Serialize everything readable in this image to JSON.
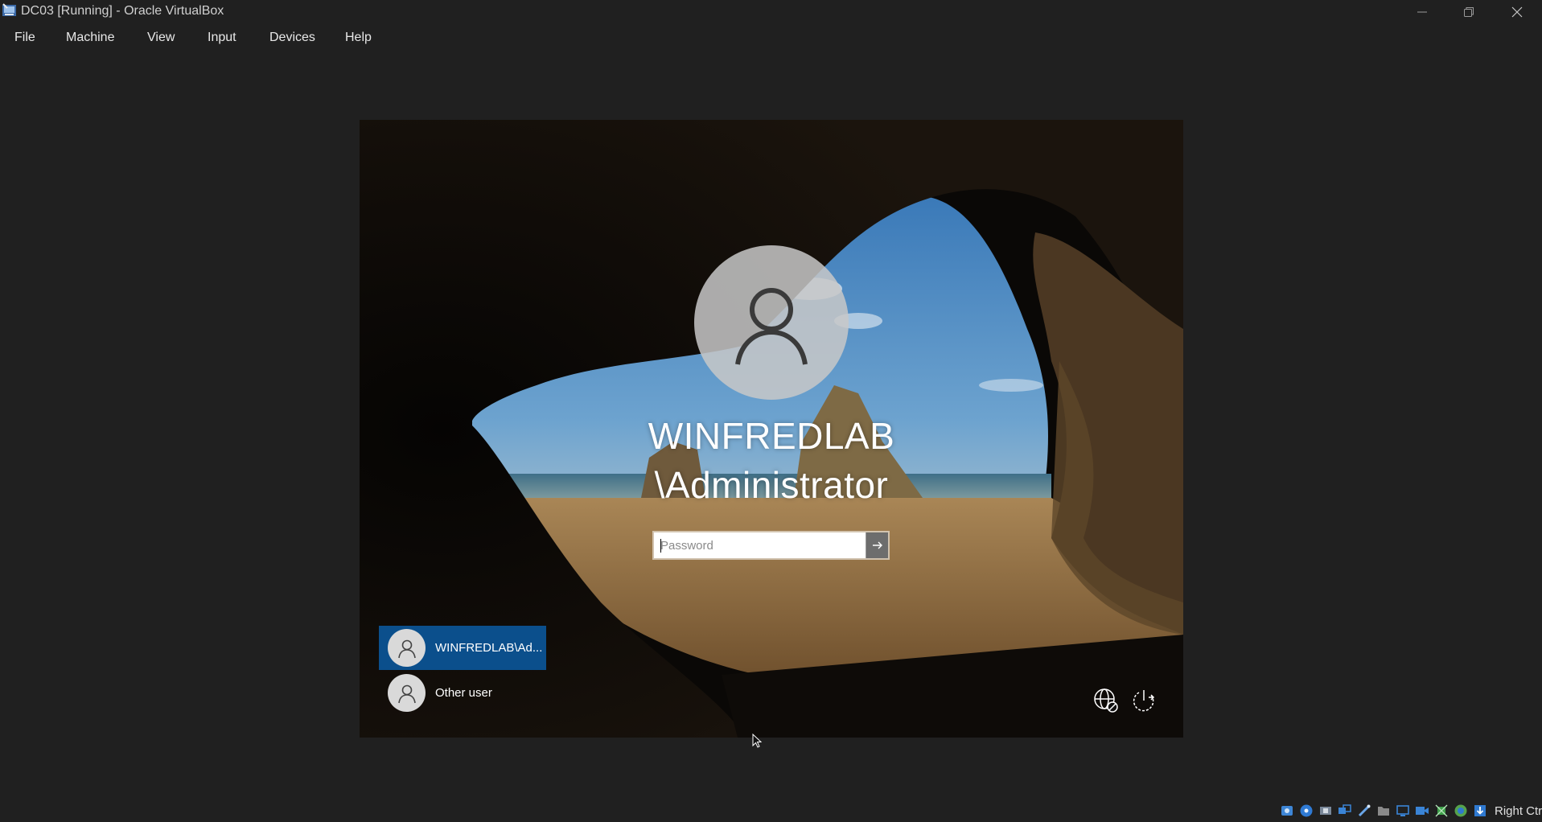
{
  "window": {
    "title": "DC03 [Running] - Oracle VirtualBox",
    "icon": "virtualbox-icon",
    "controls": [
      "minimize-icon",
      "restore-icon",
      "close-icon"
    ]
  },
  "menu": {
    "items": [
      {
        "label": "File"
      },
      {
        "label": "Machine"
      },
      {
        "label": "View"
      },
      {
        "label": "Input"
      },
      {
        "label": "Devices"
      },
      {
        "label": "Help"
      }
    ]
  },
  "login": {
    "username_line1": "WINFREDLAB",
    "username_line2": "\\Administrator",
    "password_placeholder": "Password",
    "password_value": "",
    "submit_icon": "arrow-right-icon",
    "users": [
      {
        "label": "WINFREDLAB\\Ad...",
        "selected": true
      },
      {
        "label": "Other user",
        "selected": false
      }
    ],
    "bottom_icons": [
      "network-icon",
      "power-icon"
    ]
  },
  "statusbar": {
    "icons": [
      "hard-disk-icon",
      "optical-disk-icon",
      "audio-icon",
      "network-adapter-icon",
      "usb-icon",
      "shared-folders-icon",
      "display-icon",
      "recording-icon",
      "virtualization-icon",
      "mouse-integration-icon",
      "keyboard-icon"
    ],
    "host_key": "Right Ctrl"
  },
  "colors": {
    "chrome_bg": "#202020",
    "selected_tile": "#0b4f8c"
  }
}
